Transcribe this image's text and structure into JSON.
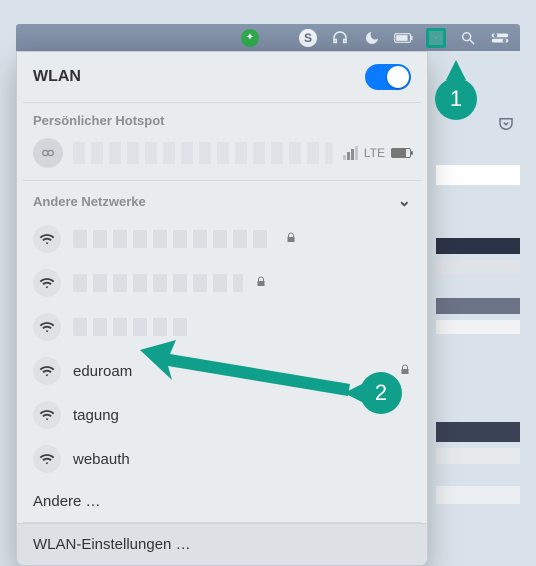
{
  "menubar": {
    "skype_letter": "S"
  },
  "panel": {
    "title": "WLAN",
    "hotspot_section": "Persönlicher Hotspot",
    "hotspot_tech": "LTE",
    "other_section": "Andere Netzwerke",
    "networks": [
      {
        "name": "",
        "blurred": true,
        "locked": true
      },
      {
        "name": "",
        "blurred": true,
        "locked": true
      },
      {
        "name": "",
        "blurred": true,
        "locked": false
      },
      {
        "name": "eduroam",
        "blurred": false,
        "locked": true
      },
      {
        "name": "tagung",
        "blurred": false,
        "locked": false
      },
      {
        "name": "webauth",
        "blurred": false,
        "locked": false
      }
    ],
    "other_link": "Andere …",
    "settings_link": "WLAN-Einstellungen …"
  },
  "callouts": {
    "one": "1",
    "two": "2"
  }
}
